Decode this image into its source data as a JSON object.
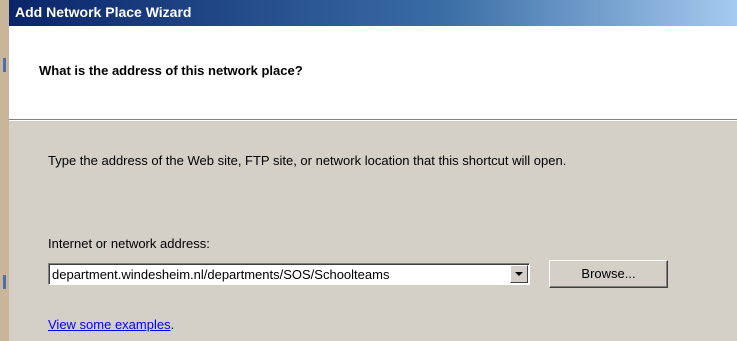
{
  "window": {
    "title": "Add Network Place Wizard"
  },
  "header": {
    "heading": "What is the address of this network place?"
  },
  "body": {
    "instructions": "Type the address of the Web site, FTP site, or network location that this shortcut will open."
  },
  "address": {
    "label": "Internet or network address:",
    "value": "department.windesheim.nl/departments/SOS/Schoolteams"
  },
  "buttons": {
    "browse": "Browse..."
  },
  "links": {
    "examples": "View some examples",
    "examples_suffix": "."
  },
  "colors": {
    "titlebar_start": "#0a246a",
    "titlebar_end": "#a6caf0",
    "dialog_bg": "#d4d0c8",
    "link": "#0000ff"
  }
}
